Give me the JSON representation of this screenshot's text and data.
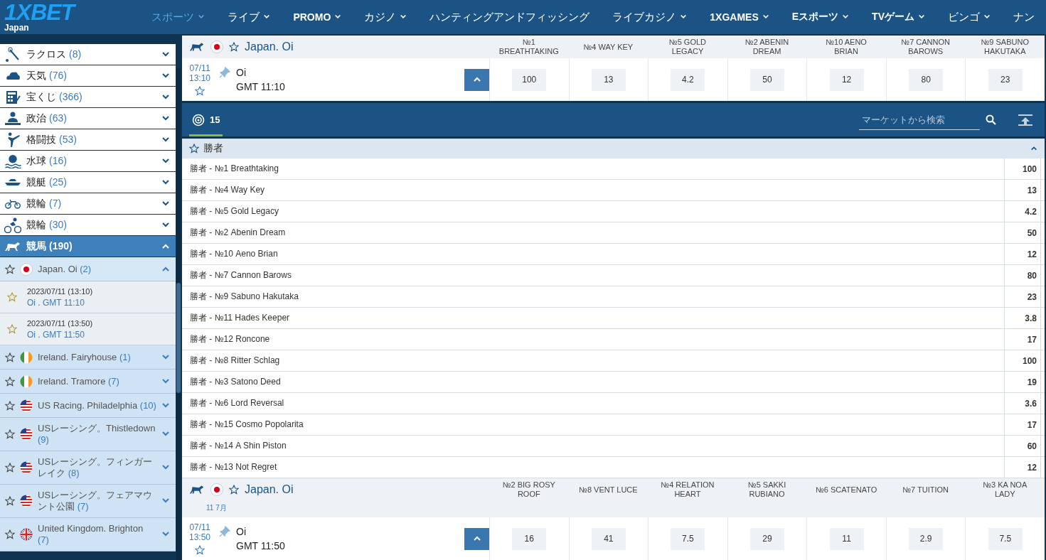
{
  "header": {
    "logo": "1XBET",
    "region": "Japan",
    "nav": [
      {
        "label": "スポーツ",
        "selected": true,
        "bold": false,
        "has_menu": true
      },
      {
        "label": "ライブ",
        "selected": false,
        "bold": false,
        "has_menu": true
      },
      {
        "label": "PROMO",
        "selected": false,
        "bold": true,
        "has_menu": true
      },
      {
        "label": "カジノ",
        "selected": false,
        "bold": false,
        "has_menu": true
      },
      {
        "label": "ハンティングアンドフィッシング",
        "selected": false,
        "bold": false,
        "has_menu": false
      },
      {
        "label": "ライブカジノ",
        "selected": false,
        "bold": false,
        "has_menu": true
      },
      {
        "label": "1XGAMES",
        "selected": false,
        "bold": true,
        "has_menu": true
      },
      {
        "label": "Eスポーツ",
        "selected": false,
        "bold": true,
        "has_menu": true
      },
      {
        "label": "TVゲーム",
        "selected": false,
        "bold": true,
        "has_menu": true
      },
      {
        "label": "ビンゴ",
        "selected": false,
        "bold": false,
        "has_menu": true
      },
      {
        "label": "ナン",
        "selected": false,
        "bold": false,
        "has_menu": false
      }
    ]
  },
  "sidebar": {
    "sports": [
      {
        "name": "ラクロス",
        "count": "(8)",
        "expanded": false
      },
      {
        "name": "天気",
        "count": "(76)",
        "expanded": false
      },
      {
        "name": "宝くじ",
        "count": "(366)",
        "expanded": false
      },
      {
        "name": "政治",
        "count": "(63)",
        "expanded": false
      },
      {
        "name": "格闘技",
        "count": "(53)",
        "expanded": false
      },
      {
        "name": "水球",
        "count": "(16)",
        "expanded": false
      },
      {
        "name": "競艇",
        "count": "(25)",
        "expanded": false
      },
      {
        "name": "競輪",
        "count": "(7)",
        "expanded": false
      },
      {
        "name": "競輪",
        "count": "(30)",
        "expanded": false
      },
      {
        "name": "競馬",
        "count": "(190)",
        "expanded": true,
        "children": [
          {
            "name": "Japan. Oi",
            "count": "(2)",
            "expanded": true,
            "events": [
              {
                "date": "2023/07/11 (13:10)",
                "venue": "Oi . GMT 11:10"
              },
              {
                "date": "2023/07/11 (13:50)",
                "venue": "Oi . GMT 11:50"
              }
            ]
          },
          {
            "name": "Ireland. Fairyhouse",
            "count": "(1)",
            "expanded": false
          },
          {
            "name": "Ireland. Tramore",
            "count": "(7)",
            "expanded": false
          },
          {
            "name": "US Racing. Philadelphia",
            "count": "(10)",
            "expanded": false
          },
          {
            "name": "USレーシング。Thistledown",
            "count": "(9)",
            "expanded": false
          },
          {
            "name": "USレーシング。フィンガーレイク",
            "count": "(8)",
            "expanded": false
          },
          {
            "name": "USレーシング。フェアマウント公園",
            "count": "(7)",
            "expanded": false
          },
          {
            "name": "United Kingdom. Brighton",
            "count": "(7)",
            "expanded": false
          }
        ]
      }
    ]
  },
  "main": [
    {
      "kind": "event",
      "tournament": "Japan. Oi",
      "day": "07/11",
      "time": "13:10",
      "name": "Oi",
      "gmt": "GMT 11:10",
      "expanded": true,
      "runners": [
        {
          "name": "№1 BREATHTAKING",
          "odds": "100"
        },
        {
          "name": "№4 WAY KEY",
          "odds": "13"
        },
        {
          "name": "№5 GOLD LEGACY",
          "odds": "4.2"
        },
        {
          "name": "№2 ABENIN DREAM",
          "odds": "50"
        },
        {
          "name": "№10 AENO BRIAN",
          "odds": "12"
        },
        {
          "name": "№7 CANNON BAROWS",
          "odds": "80"
        },
        {
          "name": "№9 SABUNO HAKUTAKA",
          "odds": "23"
        }
      ]
    },
    {
      "kind": "markets",
      "tabs": [
        {
          "label": "15",
          "selected": true
        }
      ],
      "search": {
        "placeholder": "マーケットから検索"
      },
      "groups": [
        {
          "title": "勝者",
          "expanded": true,
          "rows": [
            {
              "label": "勝者 - №1 Breathtaking",
              "odds": "100"
            },
            {
              "label": "勝者 - №4 Way Key",
              "odds": "13"
            },
            {
              "label": "勝者 - №5 Gold Legacy",
              "odds": "4.2"
            },
            {
              "label": "勝者 - №2 Abenin Dream",
              "odds": "50"
            },
            {
              "label": "勝者 - №10 Aeno Brian",
              "odds": "12"
            },
            {
              "label": "勝者 - №7 Cannon Barows",
              "odds": "80"
            },
            {
              "label": "勝者 - №9 Sabuno Hakutaka",
              "odds": "23"
            },
            {
              "label": "勝者 - №11 Hades Keeper",
              "odds": "3.8"
            },
            {
              "label": "勝者 - №12 Roncone",
              "odds": "17"
            },
            {
              "label": "勝者 - №8 Ritter Schlag",
              "odds": "100"
            },
            {
              "label": "勝者 - №3 Satono Deed",
              "odds": "19"
            },
            {
              "label": "勝者 - №6 Lord Reversal",
              "odds": "3.6"
            },
            {
              "label": "勝者 - №15 Cosmo Popolarita",
              "odds": "17"
            },
            {
              "label": "勝者 - №14 A Shin Piston",
              "odds": "60"
            },
            {
              "label": "勝者 - №13 Not Regret",
              "odds": "12"
            }
          ]
        }
      ]
    },
    {
      "kind": "event",
      "tournament": "Japan. Oi",
      "date_label": "11 7月",
      "day": "07/11",
      "time": "13:50",
      "name": "Oi",
      "gmt": "GMT 11:50",
      "expanded": true,
      "runners": [
        {
          "name": "№2 BIG ROSY ROOF",
          "odds": "16"
        },
        {
          "name": "№8 VENT LUCE",
          "odds": "41"
        },
        {
          "name": "№4 RELATION HEART",
          "odds": "7.5"
        },
        {
          "name": "№5 SAKKI RUBIANO",
          "odds": "29"
        },
        {
          "name": "№6 SCATENATO",
          "odds": "11"
        },
        {
          "name": "№7 TUITION",
          "odds": "2.9"
        },
        {
          "name": "№3 KA NOA LADY",
          "odds": "7.5"
        }
      ]
    }
  ]
}
